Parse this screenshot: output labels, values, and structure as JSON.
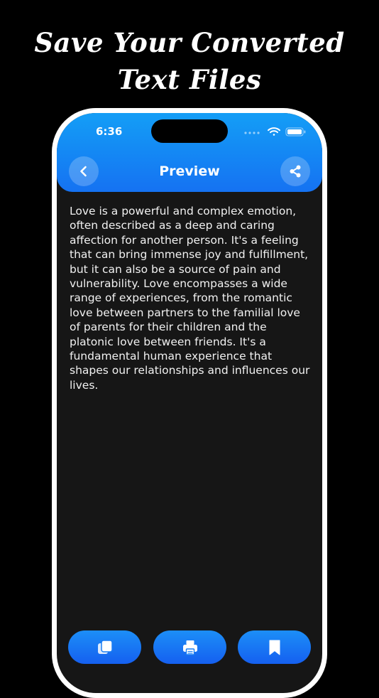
{
  "promo": {
    "headline_line1": "Save Your Converted",
    "headline_line2": "Text Files"
  },
  "status_bar": {
    "time": "6:36",
    "icons": [
      "cellular-icon",
      "wifi-icon",
      "battery-icon"
    ]
  },
  "header": {
    "title": "Preview",
    "back_icon": "chevron-left-icon",
    "share_icon": "share-icon"
  },
  "preview": {
    "text": "Love is a powerful and complex emotion, often described as a deep and caring affection for another person. It's a feeling that can bring immense joy and fulfillment, but it can also be a source of pain and vulnerability. Love encompasses a wide range of experiences, from the romantic love between partners to the familial love of parents for their children and the platonic love between friends. It's a fundamental human experience that shapes our relationships and influences our lives."
  },
  "toolbar": {
    "buttons": [
      {
        "icon": "copy-icon"
      },
      {
        "icon": "printer-icon"
      },
      {
        "icon": "bookmark-icon"
      }
    ]
  },
  "colors": {
    "background": "#000000",
    "accent_top": "#149ef6",
    "accent_bottom": "#1572f2",
    "screen": "#161616",
    "text": "#f1f1f1"
  }
}
